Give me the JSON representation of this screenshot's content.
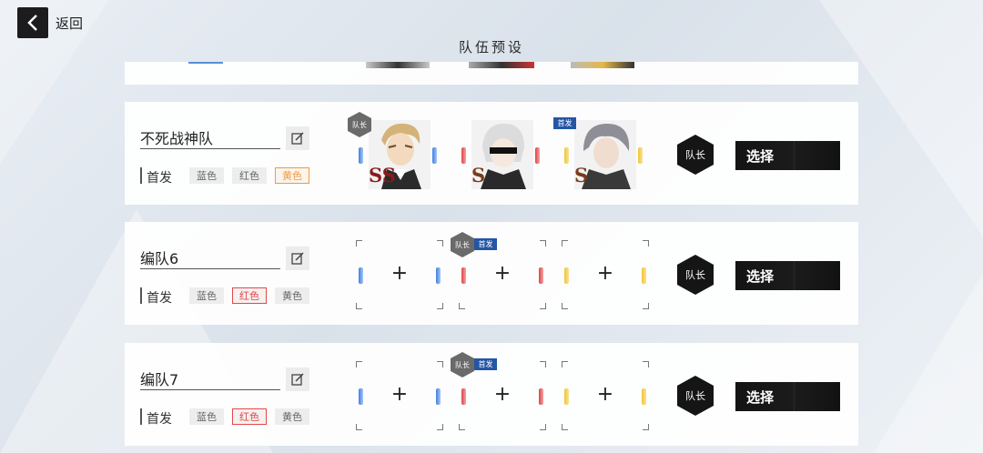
{
  "header": {
    "back_label": "返回",
    "page_title": "队伍预设"
  },
  "labels": {
    "leader": "队长",
    "first": "首发",
    "select": "选择",
    "blue": "蓝色",
    "red": "红色",
    "yellow": "黄色"
  },
  "teams": [
    {
      "name": "不死战神队",
      "selected_color": "yellow",
      "members": [
        {
          "color": "blue",
          "rank": "SS",
          "rank_color": "#8b1b1b",
          "is_leader": true,
          "is_first": false
        },
        {
          "color": "red",
          "rank": "S",
          "rank_color": "#7a3b1c",
          "is_leader": false,
          "is_first": false
        },
        {
          "color": "yellow",
          "rank": "S",
          "rank_color": "#7a3b1c",
          "is_leader": false,
          "is_first": true
        }
      ]
    },
    {
      "name": "编队6",
      "selected_color": "red",
      "members": [
        {
          "color": "blue",
          "empty": true
        },
        {
          "color": "red",
          "empty": true,
          "is_leader": true,
          "is_first": true
        },
        {
          "color": "yellow",
          "empty": true
        }
      ]
    },
    {
      "name": "编队7",
      "selected_color": "red",
      "members": [
        {
          "color": "blue",
          "empty": true
        },
        {
          "color": "red",
          "empty": true,
          "is_leader": true,
          "is_first": true
        },
        {
          "color": "yellow",
          "empty": true
        }
      ]
    }
  ],
  "colors": {
    "blue": "#3f7fe0",
    "red": "#e04242",
    "yellow": "#f1c633",
    "first_badge": "#2456a5",
    "active_red": "#e04a4a",
    "active_yellow": "#f09b3d"
  },
  "icons": [
    "back-arrow-icon",
    "edit-icon",
    "plus-icon",
    "leader-hex-icon"
  ]
}
